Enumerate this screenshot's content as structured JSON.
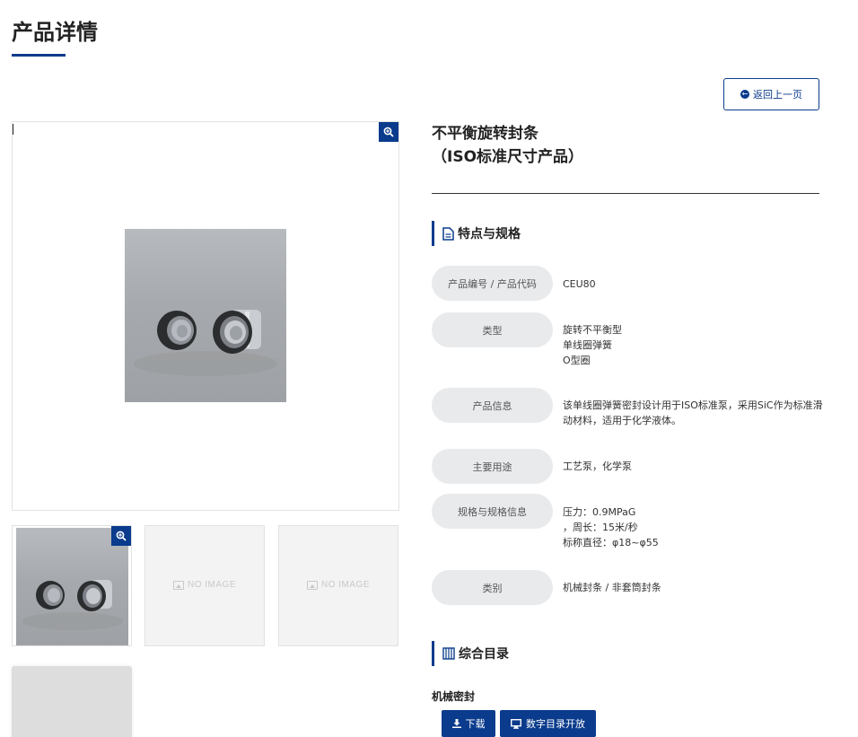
{
  "page": {
    "title": "产品详情"
  },
  "back_button": {
    "label": "返回上一页"
  },
  "gallery": {
    "no_image_label": "NO IMAGE",
    "zoom_icon": "zoom-in-icon"
  },
  "product": {
    "name_line1": "不平衡旋转封条",
    "name_line2": "（ISO标准尺寸产品）"
  },
  "specs": {
    "heading": "特点与规格",
    "rows": [
      {
        "label": "产品编号 / 产品代码",
        "value": [
          "CEU80"
        ]
      },
      {
        "label": "类型",
        "value": [
          "旋转不平衡型",
          "单线圈弹簧",
          "O型圈"
        ]
      },
      {
        "label": "产品信息",
        "value": [
          "该单线圈弹簧密封设计用于ISO标准泵，采用SiC作为标准滑动材料，适用于化学液体。"
        ]
      },
      {
        "label": "主要用途",
        "value": [
          "工艺泵，化学泵"
        ]
      },
      {
        "label": "规格与规格信息",
        "value": [
          "压力：0.9MPaG",
          "，周长：15米/秒",
          "标称直径：φ18~φ55"
        ]
      },
      {
        "label": "类别",
        "value": [
          "机械封条 / 非套筒封条"
        ]
      }
    ]
  },
  "catalog": {
    "heading": "综合目录",
    "category": "机械密封",
    "download_label": "下载",
    "digital_label": "数字目录开放"
  },
  "colors": {
    "brand_blue": "#0a3b8c",
    "pill_gray": "#e9eaec"
  }
}
